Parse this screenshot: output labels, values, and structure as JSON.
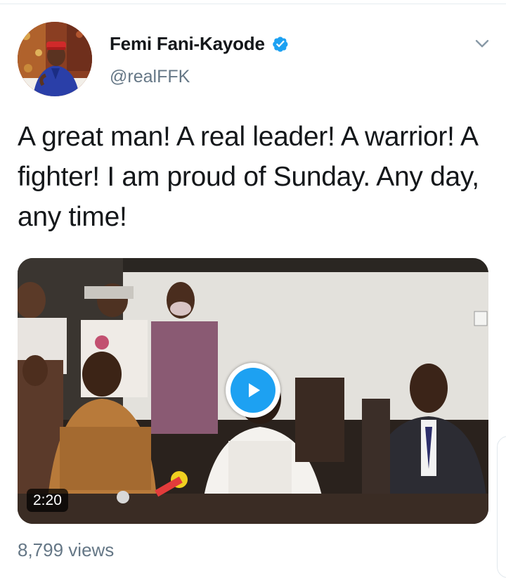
{
  "tweet": {
    "author": {
      "display_name": "Femi Fani-Kayode",
      "handle": "@realFFK",
      "verified": true,
      "avatar_icon": "profile-photo"
    },
    "menu_icon": "chevron-down-icon",
    "text": "A great man! A real leader! A warrior! A fighter! I am proud of Sunday. Any day, any time!",
    "media": {
      "type": "video",
      "duration": "2:20",
      "play_icon": "play-icon"
    },
    "views": "8,799 views"
  },
  "colors": {
    "accent": "#1da1f2",
    "text_primary": "#14171a",
    "text_secondary": "#657786"
  }
}
